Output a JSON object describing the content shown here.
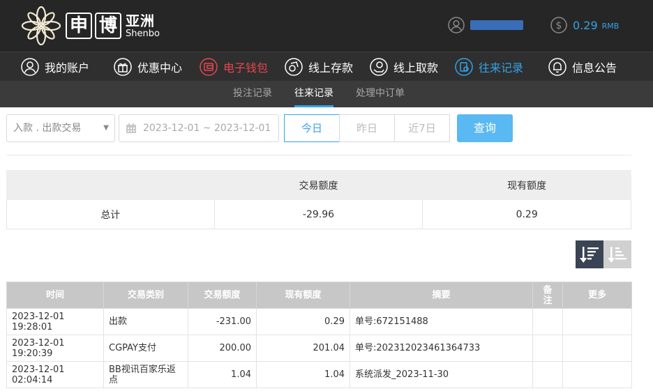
{
  "brand": {
    "char1": "申",
    "char2": "博",
    "cn": "亚洲",
    "en": "Shenbo"
  },
  "account": {
    "balance": "0.29",
    "currency": "RMB"
  },
  "main_nav": [
    {
      "label": "我的账户",
      "icon": "user-icon"
    },
    {
      "label": "优惠中心",
      "icon": "gift-icon"
    },
    {
      "label": "电子钱包",
      "icon": "wallet-icon"
    },
    {
      "label": "线上存款",
      "icon": "deposit-icon"
    },
    {
      "label": "线上取款",
      "icon": "withdraw-icon"
    },
    {
      "label": "往来记录",
      "icon": "records-icon"
    },
    {
      "label": "信息公告",
      "icon": "bell-icon"
    }
  ],
  "sub_nav": [
    "投注记录",
    "往来记录",
    "处理中订单"
  ],
  "filters": {
    "type_value": "入款 . 出款交易",
    "date_range": "2023-12-01 ~ 2023-12-01",
    "day_buttons": [
      "今日",
      "昨日",
      "近7日"
    ],
    "query_label": "查询"
  },
  "summary": {
    "headers": [
      "交易额度",
      "现有额度"
    ],
    "row_label": "总计",
    "trade_total": "-29.96",
    "current_total": "0.29"
  },
  "records": {
    "headers": [
      "时间",
      "交易类别",
      "交易额度",
      "现有额度",
      "摘要",
      "备注",
      "更多"
    ],
    "rows": [
      [
        "2023-12-01 19:28:01",
        "出款",
        "-231.00",
        "0.29",
        "单号:672151488",
        "",
        ""
      ],
      [
        "2023-12-01 19:20:39",
        "CGPAY支付",
        "200.00",
        "201.04",
        "单号:202312023461364733",
        "",
        ""
      ],
      [
        "2023-12-01 02:04:14",
        "BB视讯百家乐返点",
        "1.04",
        "1.04",
        "系统派发_2023-11-30",
        "",
        ""
      ]
    ]
  }
}
